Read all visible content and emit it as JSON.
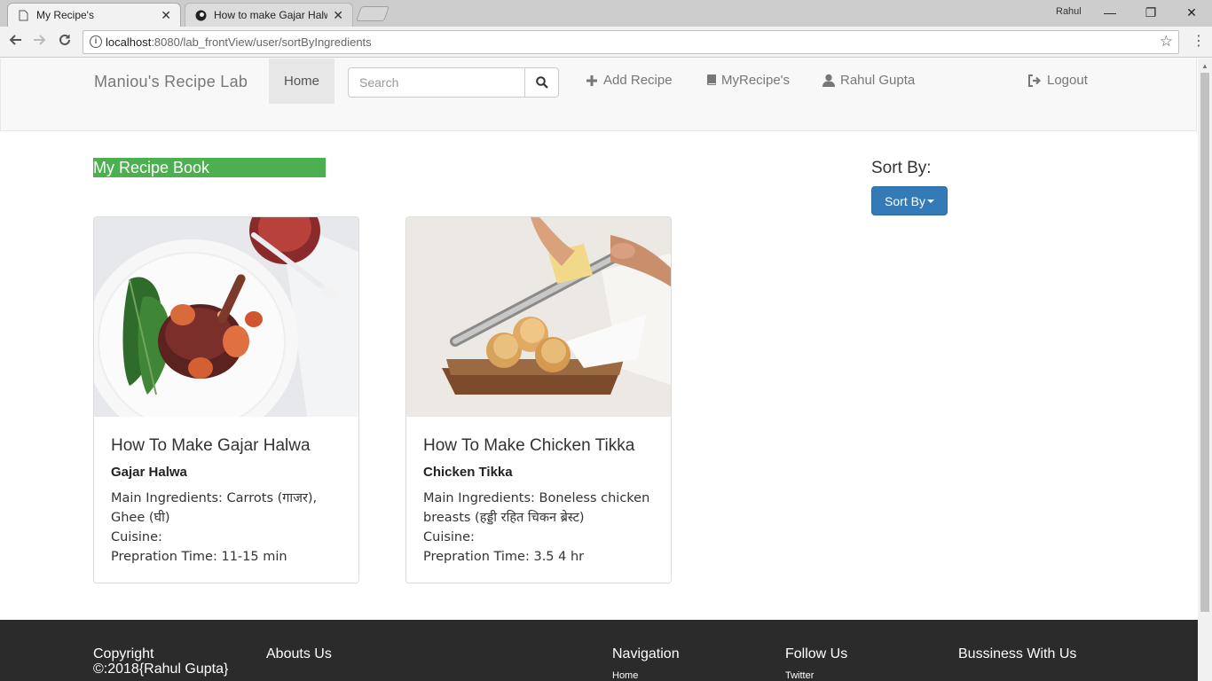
{
  "browser": {
    "tabs": [
      {
        "title": "My Recipe's",
        "active": true
      },
      {
        "title": "How to make Gajar Halwa",
        "active": false
      }
    ],
    "window_user": "Rahul",
    "url_host": "localhost",
    "url_rest": ":8080/lab_frontView/user/sortByIngredients"
  },
  "navbar": {
    "brand": "Maniou's Recipe Lab",
    "home": "Home",
    "search_placeholder": "Search",
    "add_recipe": "Add Recipe",
    "my_recipes": "MyRecipe's",
    "user": "Rahul Gupta",
    "logout": "Logout"
  },
  "main": {
    "book_title": "My Recipe Book",
    "sort_label": "Sort By:",
    "sort_button": "Sort By"
  },
  "recipes": [
    {
      "title": "How To Make Gajar Halwa",
      "subtitle": "Gajar Halwa",
      "ingredients": "Main Ingredients: Carrots (गाजर), Ghee (घी)",
      "cuisine": "Cuisine:",
      "time": "Prepration Time: 11-15 min"
    },
    {
      "title": "How To Make Chicken Tikka",
      "subtitle": "Chicken Tikka",
      "ingredients": "Main Ingredients: Boneless chicken breasts (हड्डी रहित चिकन ब्रेस्ट)",
      "cuisine": "Cuisine:",
      "time": "Prepration Time: 3.5 4 hr"
    }
  ],
  "footer": {
    "copyright": "Copyright ©:2018{Rahul Gupta}",
    "about": "Abouts Us",
    "navigation": "Navigation",
    "nav_home": "Home",
    "follow": "Follow Us",
    "twitter": "Twitter",
    "business": "Bussiness With Us"
  },
  "colors": {
    "accent_green": "#4caf50",
    "button_blue": "#337ab7",
    "footer_bg": "#2b2b2b"
  }
}
